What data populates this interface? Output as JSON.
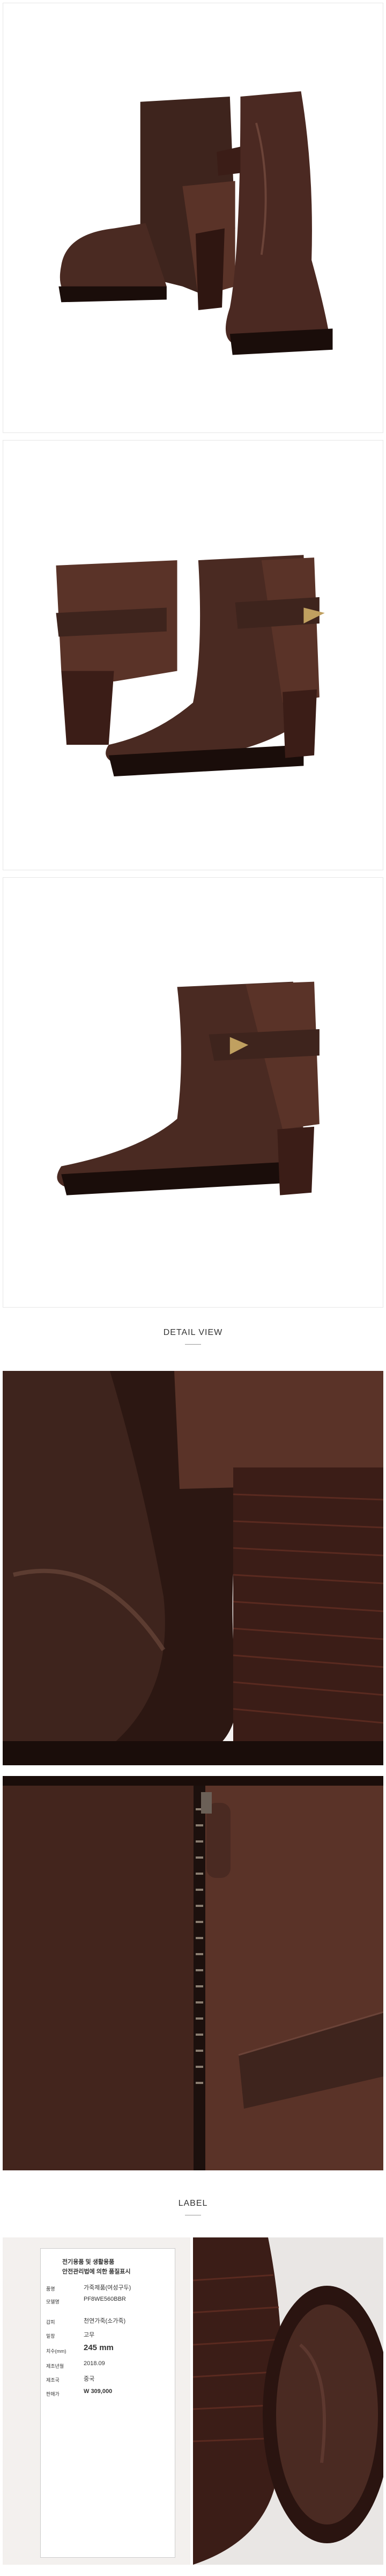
{
  "sections": {
    "detail_title": "DETAIL VIEW",
    "label_title": "LABEL"
  },
  "images": [
    {
      "alt": "brown-boots-pair-front"
    },
    {
      "alt": "brown-boots-pair-back"
    },
    {
      "alt": "brown-boot-single-side"
    },
    {
      "alt": "detail-toe-heel"
    },
    {
      "alt": "detail-zipper-strap"
    },
    {
      "alt": "label-card"
    },
    {
      "alt": "detail-heel-sole"
    }
  ],
  "label": {
    "line1": "전기용품 및 생활용품",
    "line2": "안전관리법에 의한 품질표시",
    "product_key": "품명",
    "product_val": "가죽제품(여성구두)",
    "model_key": "모델명",
    "model_val": "PF8WE560BBR",
    "upper_key": "갑피",
    "upper_val": "천연가죽(소가죽)",
    "sole_key": "밑창",
    "sole_val": "고무",
    "size_key": "치수(mm)",
    "size_val": "245 mm",
    "date_key": "제조년월",
    "date_val": "2018.09",
    "origin_key": "제조국",
    "origin_val": "중국",
    "price_key": "판매가",
    "price_val": "W 309,000"
  },
  "colors": {
    "leather": "#4a2a22",
    "suede": "#5a3328",
    "heel": "#3b1d17",
    "background": "#ffffff"
  }
}
